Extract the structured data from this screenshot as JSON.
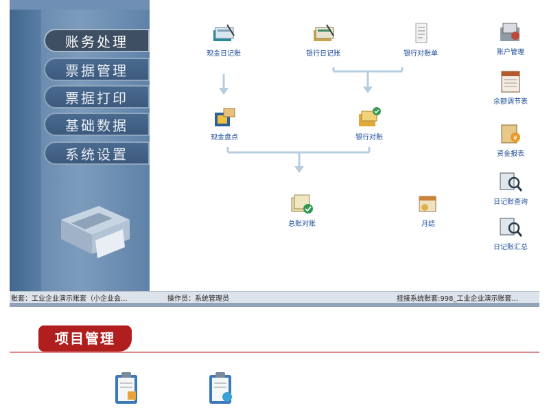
{
  "sidebar": {
    "items": [
      {
        "label": "账务处理",
        "active": true
      },
      {
        "label": "票据管理",
        "active": false
      },
      {
        "label": "票据打印",
        "active": false
      },
      {
        "label": "基础数据",
        "active": false
      },
      {
        "label": "系统设置",
        "active": false
      }
    ]
  },
  "flow": {
    "cash_journal": "现金日记账",
    "bank_journal": "银行日记账",
    "bank_statement": "银行对账单",
    "cash_count": "现金盘点",
    "bank_reconcile": "银行对账",
    "ledger_reconcile": "总账对账",
    "month_close": "月结"
  },
  "right_tools": {
    "account_mgmt": "账户管理",
    "balance_adjust": "余额调节表",
    "funds_report": "资金报表",
    "journal_query": "日记账查询",
    "journal_summary": "日记账汇总"
  },
  "status": {
    "account_set": "账套：工业企业演示账套（小企业会...",
    "operator": "操作员：系统管理员",
    "linked": "挂接系统账套:998_工业企业演示账套..."
  },
  "project_section": {
    "title": "项目管理"
  },
  "colors": {
    "accent_red": "#b01e1e",
    "link_blue": "#1f4e9a",
    "sidebar_blue": "#5d7fa3"
  }
}
